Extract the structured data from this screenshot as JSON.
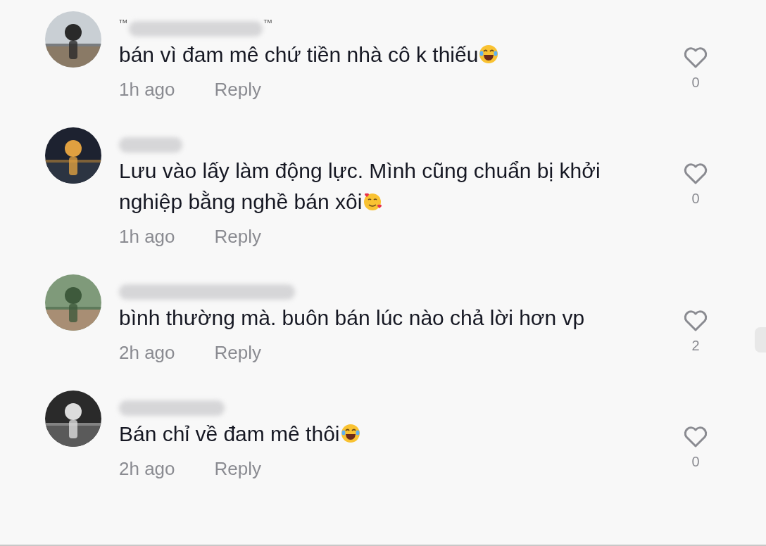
{
  "comments": [
    {
      "name_marks": [
        "TM",
        "TM"
      ],
      "text": "bán vì đam mê chứ tiền nhà cô k thiếu",
      "emoji": {
        "kind": "tears-of-joy"
      },
      "time": "1h ago",
      "reply": "Reply",
      "likes": "0"
    },
    {
      "text": "Lưu vào lấy làm động lực. Mình cũng chuẩn bị khởi nghiệp bằng nghề bán xôi",
      "emoji": {
        "kind": "smiling-hearts"
      },
      "time": "1h ago",
      "reply": "Reply",
      "likes": "0"
    },
    {
      "text": "bình thường mà. buôn bán lúc nào chả lời hơn vp",
      "time": "2h ago",
      "reply": "Reply",
      "likes": "2"
    },
    {
      "text": "Bán chỉ về đam mê thôi",
      "emoji": {
        "kind": "tears-of-joy"
      },
      "time": "2h ago",
      "reply": "Reply",
      "likes": "0"
    }
  ]
}
